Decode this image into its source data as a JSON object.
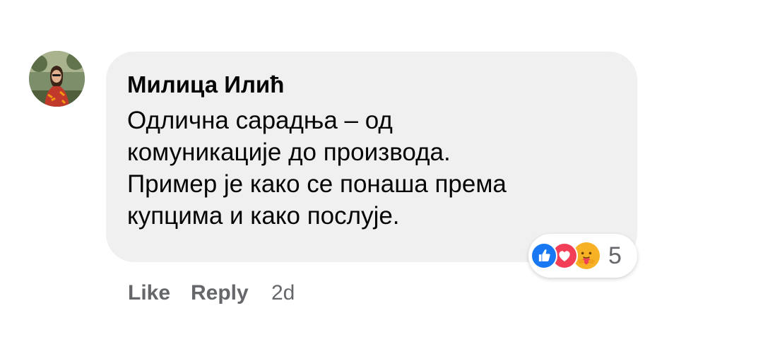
{
  "comment": {
    "author": "Милица Илић",
    "avatar_icon": "profile-photo",
    "text_lines": [
      "Одлична сарадња – од",
      "комуникације до производа.",
      "Пример је како се понаша према",
      "купцима и како послује."
    ],
    "reactions": {
      "types": [
        "like-icon",
        "love-icon",
        "care-icon"
      ],
      "count": "5"
    },
    "actions": {
      "like": "Like",
      "reply": "Reply",
      "timestamp": "2d"
    }
  },
  "colors": {
    "bubble": "#f0f0f0",
    "text": "#050505",
    "secondary": "#65676b",
    "like": "#1877f2",
    "love": "#f33e58",
    "care": "#f7b125"
  }
}
